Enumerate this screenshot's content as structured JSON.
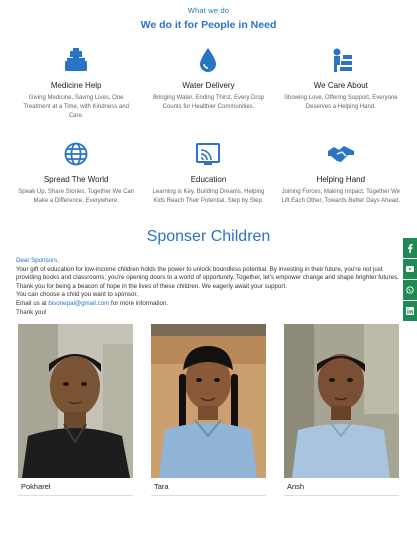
{
  "header": {
    "eyebrow": "What we do",
    "title": "We do it for People in Need"
  },
  "services": [
    {
      "icon": "medicine-kit-icon",
      "title": "Medicine Help",
      "desc": "Giving Medicine, Saving Lives, One Treatment at a Time, with Kindness and Care."
    },
    {
      "icon": "water-drop-icon",
      "title": "Water Delivery",
      "desc": "Bringing Water, Ending Thirst, Every Drop Counts for Healthier Communities."
    },
    {
      "icon": "care-hands-icon",
      "title": "We Care About",
      "desc": "Showing Love, Offering Support, Everyone Deserves a Helping Hand."
    },
    {
      "icon": "globe-icon",
      "title": "Spread The World",
      "desc": "Speak Up, Share Stories, Together We Can Make a Difference, Everywhere."
    },
    {
      "icon": "education-screen-icon",
      "title": "Education",
      "desc": "Learning is Key, Building Dreams, Helping Kids Reach Their Potential, Step by Step."
    },
    {
      "icon": "handshake-icon",
      "title": "Helping Hand",
      "desc": "Joining Forces, Making Impact, Together We Lift Each Other, Towards Better Days Ahead."
    }
  ],
  "sponsor": {
    "title": "Sponser Children",
    "greeting": "Dear Sponsors,",
    "paragraph": "Your gift of education for low-income children holds the power to unlock boundless potential. By investing in their future, you're not just providing books and classrooms; you're opening doors to a world of opportunity. Together, let's empower change and shape brighter futures. Thank you for being a beacon of hope in the lives of these children. We eagerly await your support.",
    "choose_line": "You can choose a child you want to sponsor.",
    "email_prefix": "Email us at",
    "email": "bisonepal@gmail.com",
    "email_suffix": "for more information.",
    "thanks": "Thank you!"
  },
  "children": [
    {
      "name": "Pokharel",
      "shirt": "#1d1d1d",
      "bg": "#b8b8aa",
      "skin": "#7a5234"
    },
    {
      "name": "Tara",
      "shirt": "#8fb4d6",
      "bg": "#c79a6a",
      "skin": "#8a5a38"
    },
    {
      "name": "Ansh",
      "shirt": "#a9c4de",
      "bg": "#9e9e8c",
      "skin": "#7a4f33"
    }
  ],
  "social": [
    "facebook-icon",
    "youtube-icon",
    "whatsapp-icon",
    "linkedin-icon"
  ],
  "colors": {
    "accent": "#2a73c5",
    "social": "#1f8a54"
  }
}
